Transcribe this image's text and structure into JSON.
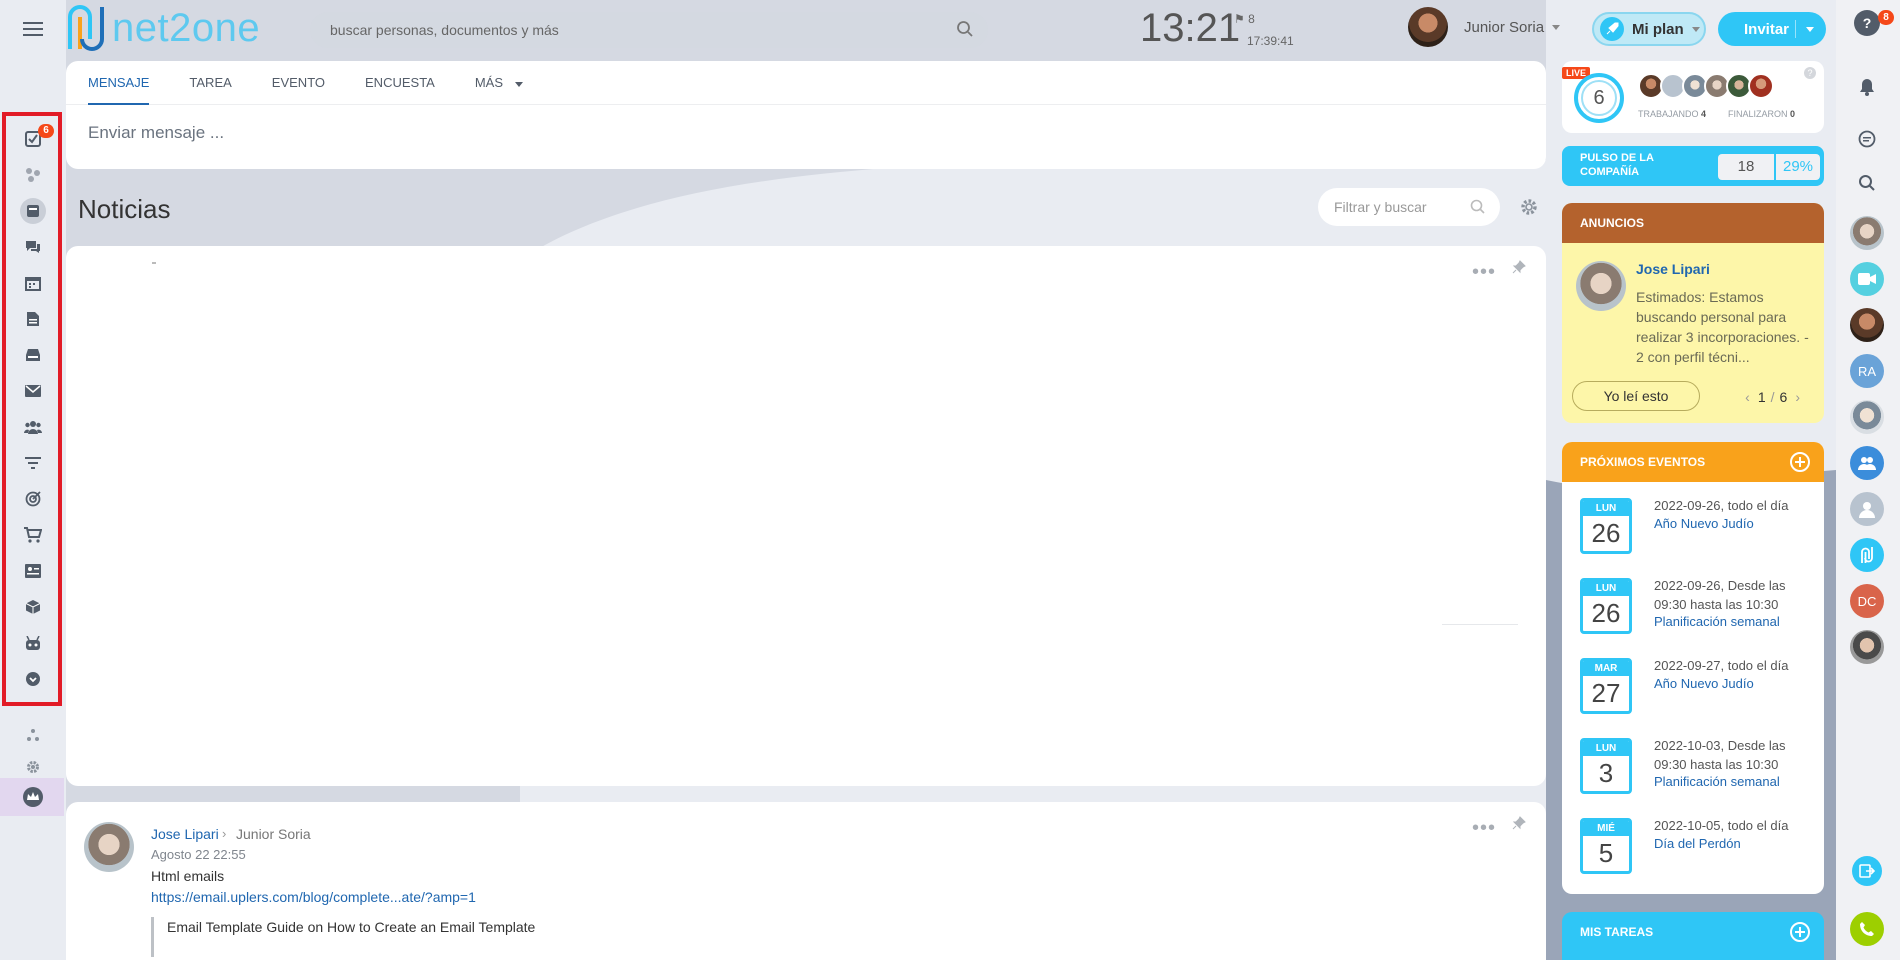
{
  "header": {
    "logo_text": "net2one",
    "search_placeholder": "buscar personas, documentos y más",
    "clock": "13:21",
    "flag_count": "8",
    "clock_seconds": "17:39:41",
    "user_name": "Junior Soria",
    "plan_label": "Mi plan",
    "invite_label": "Invitar"
  },
  "left_sidebar": {
    "tasks_badge": "6",
    "icons": [
      "tasks-icon",
      "crm-icon",
      "feed-icon",
      "chat-icon",
      "calendar-icon",
      "documents-icon",
      "drive-icon",
      "mail-icon",
      "groups-icon",
      "filter-icon",
      "target-icon",
      "cart-icon",
      "contact-card-icon",
      "box-icon",
      "robot-icon",
      "more-icon"
    ],
    "bottom_icons": [
      "sitemap-icon",
      "settings-icon",
      "crown-icon"
    ]
  },
  "right_sidebar": {
    "help_badge": "8",
    "avatar_initials": [
      "RA",
      "DC"
    ]
  },
  "composer": {
    "tabs": [
      "MENSAJE",
      "TAREA",
      "EVENTO",
      "ENCUESTA",
      "MÁS"
    ],
    "placeholder": "Enviar mensaje ..."
  },
  "news": {
    "title": "Noticias",
    "filter_placeholder": "Filtrar y buscar"
  },
  "post": {
    "author": "Jose Lipari",
    "target": "Junior Soria",
    "date": "Agosto 22 22:55",
    "text": "Html emails",
    "link": "https://email.uplers.com/blog/complete...ate/?amp=1",
    "quote": "Email Template Guide on How to Create an Email Template"
  },
  "live": {
    "tag": "LIVE",
    "count": "6",
    "working_label": "TRABAJANDO",
    "working_count": "4",
    "finished_label": "FINALIZARON",
    "finished_count": "0"
  },
  "pulse": {
    "label": "PULSO DE LA COMPAÑÍA",
    "value": "18",
    "percent": "29%"
  },
  "announcements": {
    "title": "ANUNCIOS",
    "author": "Jose Lipari",
    "text": "Estimados: Estamos buscando personal para realizar 3 incorporaciones. - 2 con perfil técni...",
    "read_button": "Yo leí esto",
    "page_current": "1",
    "page_sep": "/",
    "page_total": "6"
  },
  "events": {
    "title": "PRÓXIMOS EVENTOS",
    "items": [
      {
        "day": "LUN",
        "num": "26",
        "when": "2022-09-26, todo el día",
        "title": "Año Nuevo Judío"
      },
      {
        "day": "LUN",
        "num": "26",
        "when": "2022-09-26, Desde las 09:30 hasta las 10:30",
        "title": "Planificación semanal"
      },
      {
        "day": "MAR",
        "num": "27",
        "when": "2022-09-27, todo el día",
        "title": "Año Nuevo Judío"
      },
      {
        "day": "LUN",
        "num": "3",
        "when": "2022-10-03, Desde las 09:30 hasta las 10:30",
        "title": "Planificación semanal"
      },
      {
        "day": "MIÉ",
        "num": "5",
        "when": "2022-10-05, todo el día",
        "title": "Día del Perdón"
      }
    ]
  },
  "tasks": {
    "title": "MIS TAREAS"
  },
  "colors": {
    "accent": "#2fc6f6",
    "link": "#2067b0",
    "announce_head": "#b4622d",
    "announce_bg": "#fdf6a9",
    "events_head": "#f9a21b",
    "badge": "#f54819",
    "highlight_box": "#e21b27"
  }
}
